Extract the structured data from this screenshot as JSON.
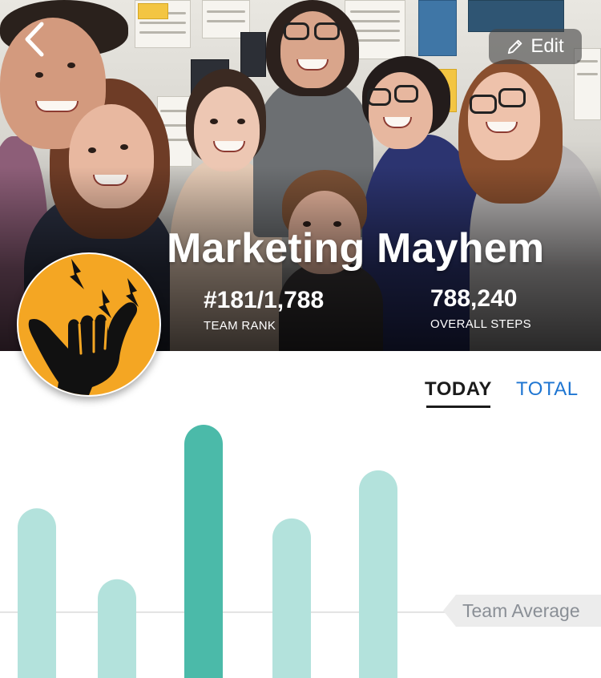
{
  "header": {
    "back_icon": "chevron-left-icon",
    "edit_label": "Edit",
    "edit_icon": "pencil-icon",
    "team_name": "Marketing Mayhem",
    "rank": {
      "value": "#181/1,788",
      "label": "TEAM RANK"
    },
    "steps": {
      "value": "788,240",
      "label": "OVERALL STEPS"
    },
    "badge_icon": "shaka-hand-lightning-icon",
    "badge_color": "#f4a623"
  },
  "tabs": [
    {
      "label": "TODAY",
      "active": true
    },
    {
      "label": "TOTAL",
      "active": false
    }
  ],
  "colors": {
    "bar": "#b3e2dc",
    "bar_highlight": "#4bbaa9",
    "tab_active": "#1b1b1b",
    "tab_inactive": "#1f76d2"
  },
  "chart_data": {
    "type": "bar",
    "categories": [
      "",
      "",
      "",
      "",
      ""
    ],
    "values": [
      0.67,
      0.39,
      1.0,
      0.63,
      0.82
    ],
    "highlight_index": 2,
    "reference_line": {
      "label": "Team Average",
      "value": 0.26
    }
  }
}
